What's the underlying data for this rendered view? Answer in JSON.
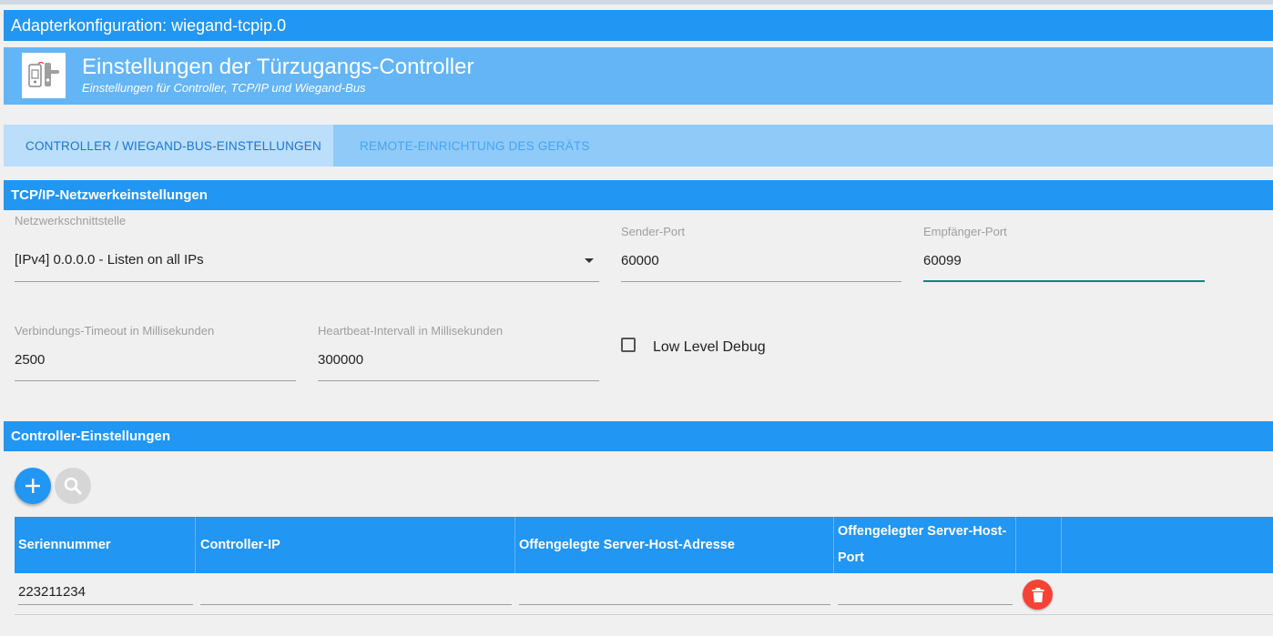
{
  "window": {
    "title": "Adapterkonfiguration: wiegand-tcpip.0"
  },
  "header": {
    "title": "Einstellungen der Türzugangs-Controller",
    "subtitle": "Einstellungen für Controller, TCP/IP und Wiegand-Bus"
  },
  "tabs": [
    {
      "label": "CONTROLLER / WIEGAND-BUS-EINSTELLUNGEN",
      "active": true
    },
    {
      "label": "REMOTE-EINRICHTUNG DES GERÄTS",
      "active": false
    }
  ],
  "tcpip": {
    "section_title": "TCP/IP-Netzwerkeinstellungen",
    "interface": {
      "label": "Netzwerkschnittstelle",
      "value": "[IPv4] 0.0.0.0 - Listen on all IPs"
    },
    "sender_port": {
      "label": "Sender-Port",
      "value": "60000"
    },
    "receiver_port": {
      "label": "Empfänger-Port",
      "value": "60099"
    },
    "timeout": {
      "label": "Verbindungs-Timeout in Millisekunden",
      "value": "2500"
    },
    "heartbeat": {
      "label": "Heartbeat-Intervall in Millisekunden",
      "value": "300000"
    },
    "low_level_debug": {
      "label": "Low Level Debug",
      "checked": false
    }
  },
  "controllers": {
    "section_title": "Controller-Einstellungen",
    "columns": [
      "Seriennummer",
      "Controller-IP",
      "Offengelegte Server-Host-Adresse",
      "Offengelegter Server-Host-Port"
    ],
    "rows": [
      {
        "serial": "223211234",
        "ip": "",
        "host_address": "",
        "host_port": ""
      }
    ]
  },
  "icons": {
    "logo": "door-lock-controller-icon",
    "dropdown": "chevron-down-icon",
    "add": "plus-icon",
    "search": "search-icon",
    "delete": "trash-icon"
  },
  "colors": {
    "primary": "#2196f3",
    "header": "#64b5f6",
    "tabs": "#90caf9",
    "focus": "#00897b",
    "delete": "#f44336"
  }
}
